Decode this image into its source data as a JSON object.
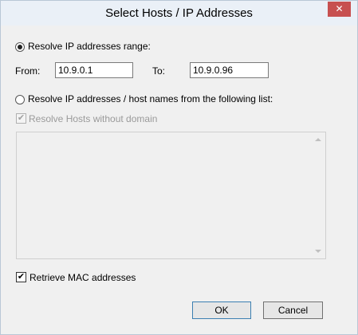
{
  "window": {
    "title": "Select Hosts / IP Addresses",
    "close_glyph": "✕"
  },
  "range_option": {
    "label": "Resolve IP addresses range:",
    "selected": true,
    "from_label": "From:",
    "from_value": "10.9.0.1",
    "to_label": "To:",
    "to_value": "10.9.0.96"
  },
  "list_option": {
    "label": "Resolve IP addresses / host names from the following list:",
    "selected": false,
    "without_domain_label": "Resolve Hosts without domain",
    "without_domain_checked": true,
    "without_domain_enabled": false,
    "list_items": []
  },
  "retrieve_mac": {
    "label": "Retrieve MAC addresses",
    "checked": true
  },
  "buttons": {
    "ok": "OK",
    "cancel": "Cancel"
  },
  "icons": {
    "check": "✔",
    "scroll_up": "chevron-up-icon",
    "scroll_down": "chevron-down-icon"
  }
}
